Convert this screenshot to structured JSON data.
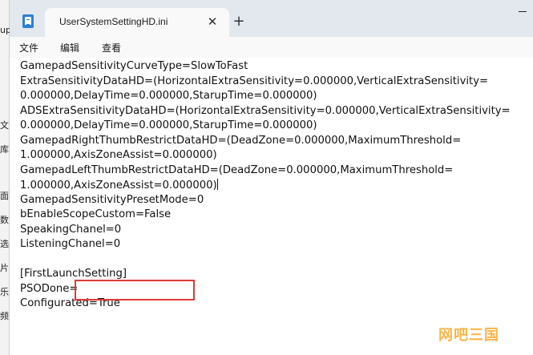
{
  "window": {
    "tab_title": "UserSystemSettingHD.ini",
    "tab_close_glyph": "✕",
    "new_tab_glyph": "+"
  },
  "menu": {
    "file": "文件",
    "edit": "编辑",
    "view": "查看"
  },
  "background_window": {
    "fragments": [
      "up",
      "文",
      "库",
      "面",
      "数",
      "选",
      "片",
      "乐",
      "频"
    ]
  },
  "editor": {
    "lines": [
      "GamepadSensitivityCurveType=SlowToFast",
      "ExtraSensitivityDataHD=(HorizontalExtraSensitivity=0.000000,VerticalExtraSensitivity=",
      "0.000000,DelayTime=0.000000,StarupTime=0.000000)",
      "ADSExtraSensitivityDataHD=(HorizontalExtraSensitivity=0.000000,VerticalExtraSensitivity=",
      "0.000000,DelayTime=0.000000,StarupTime=0.000000)",
      "GamepadRightThumbRestrictDataHD=(DeadZone=0.000000,MaximumThreshold=",
      "1.000000,AxisZoneAssist=0.000000)",
      "GamepadLeftThumbRestrictDataHD=(DeadZone=0.000000,MaximumThreshold=",
      "1.000000,AxisZoneAssist=0.000000)",
      "GamepadSensitivityPresetMode=0",
      "bEnableScopeCustom=False",
      "SpeakingChanel=0",
      "ListeningChanel=0",
      "",
      "[FirstLaunchSetting]",
      "PSODone=",
      "Configurated=True"
    ]
  },
  "watermark": {
    "text": "网吧三国"
  },
  "colors": {
    "highlight_box": "#e03a3a",
    "watermark": "#f7b54a"
  },
  "icons": {
    "app": "notepad-icon",
    "close": "close-icon",
    "new_tab": "plus-icon"
  }
}
